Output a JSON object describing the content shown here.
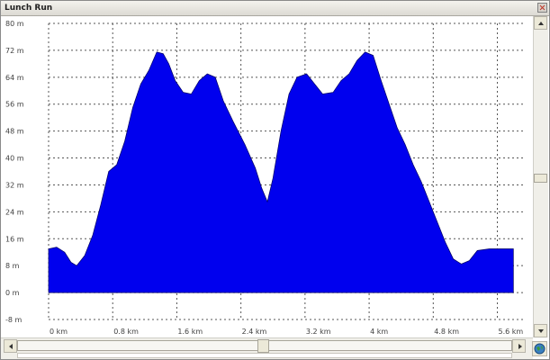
{
  "window": {
    "title": "Lunch Run"
  },
  "colors": {
    "fill": "#0000ee",
    "grid": "#555555"
  },
  "icons": {
    "close": "close-icon",
    "scroll_up": "arrow-up-icon",
    "scroll_down": "arrow-down-icon",
    "scroll_left": "arrow-left-icon",
    "scroll_right": "arrow-right-icon",
    "globe": "globe-icon"
  },
  "chart_data": {
    "type": "area",
    "title": "",
    "xlabel": "",
    "ylabel": "",
    "x_unit": "km",
    "y_unit": "m",
    "xlim": [
      0,
      5.92
    ],
    "ylim": [
      -8,
      80
    ],
    "grid": true,
    "y_ticks": [
      "80 m",
      "72 m",
      "64 m",
      "56 m",
      "48 m",
      "40 m",
      "32 m",
      "24 m",
      "16 m",
      "8 m",
      "0 m",
      "-8 m"
    ],
    "y_tick_values": [
      80,
      72,
      64,
      56,
      48,
      40,
      32,
      24,
      16,
      8,
      0,
      -8
    ],
    "x_ticks": [
      "0 km",
      "0.8 km",
      "1.6 km",
      "2.4 km",
      "3.2 km",
      "4 km",
      "4.8 km",
      "5.6 km"
    ],
    "x_tick_values": [
      0,
      0.8,
      1.6,
      2.4,
      3.2,
      4.0,
      4.8,
      5.6
    ],
    "series": [
      {
        "values": [
          [
            0.0,
            13.0
          ],
          [
            0.1,
            13.5
          ],
          [
            0.2,
            12.0
          ],
          [
            0.28,
            9.0
          ],
          [
            0.35,
            8.0
          ],
          [
            0.45,
            11.0
          ],
          [
            0.55,
            17.0
          ],
          [
            0.65,
            26.0
          ],
          [
            0.75,
            36.0
          ],
          [
            0.85,
            38.0
          ],
          [
            0.95,
            45.0
          ],
          [
            1.05,
            55.0
          ],
          [
            1.15,
            62.0
          ],
          [
            1.25,
            66.0
          ],
          [
            1.35,
            71.5
          ],
          [
            1.43,
            71.0
          ],
          [
            1.5,
            68.0
          ],
          [
            1.58,
            63.0
          ],
          [
            1.68,
            59.5
          ],
          [
            1.78,
            59.0
          ],
          [
            1.88,
            63.0
          ],
          [
            1.98,
            65.0
          ],
          [
            2.08,
            64.0
          ],
          [
            2.18,
            57.0
          ],
          [
            2.3,
            51.0
          ],
          [
            2.45,
            44.0
          ],
          [
            2.58,
            37.0
          ],
          [
            2.66,
            31.0
          ],
          [
            2.73,
            27.0
          ],
          [
            2.8,
            34.0
          ],
          [
            2.9,
            48.0
          ],
          [
            3.0,
            59.0
          ],
          [
            3.1,
            64.0
          ],
          [
            3.22,
            65.0
          ],
          [
            3.32,
            62.0
          ],
          [
            3.42,
            59.0
          ],
          [
            3.55,
            59.5
          ],
          [
            3.65,
            63.0
          ],
          [
            3.75,
            65.0
          ],
          [
            3.85,
            69.0
          ],
          [
            3.95,
            71.5
          ],
          [
            4.05,
            70.5
          ],
          [
            4.15,
            63.0
          ],
          [
            4.25,
            56.0
          ],
          [
            4.35,
            49.0
          ],
          [
            4.45,
            44.0
          ],
          [
            4.55,
            38.0
          ],
          [
            4.65,
            33.0
          ],
          [
            4.75,
            27.0
          ],
          [
            4.85,
            21.0
          ],
          [
            4.95,
            15.0
          ],
          [
            5.05,
            10.0
          ],
          [
            5.15,
            8.5
          ],
          [
            5.25,
            9.5
          ],
          [
            5.35,
            12.5
          ],
          [
            5.5,
            13.0
          ],
          [
            5.65,
            13.0
          ],
          [
            5.8,
            13.0
          ]
        ]
      }
    ]
  }
}
